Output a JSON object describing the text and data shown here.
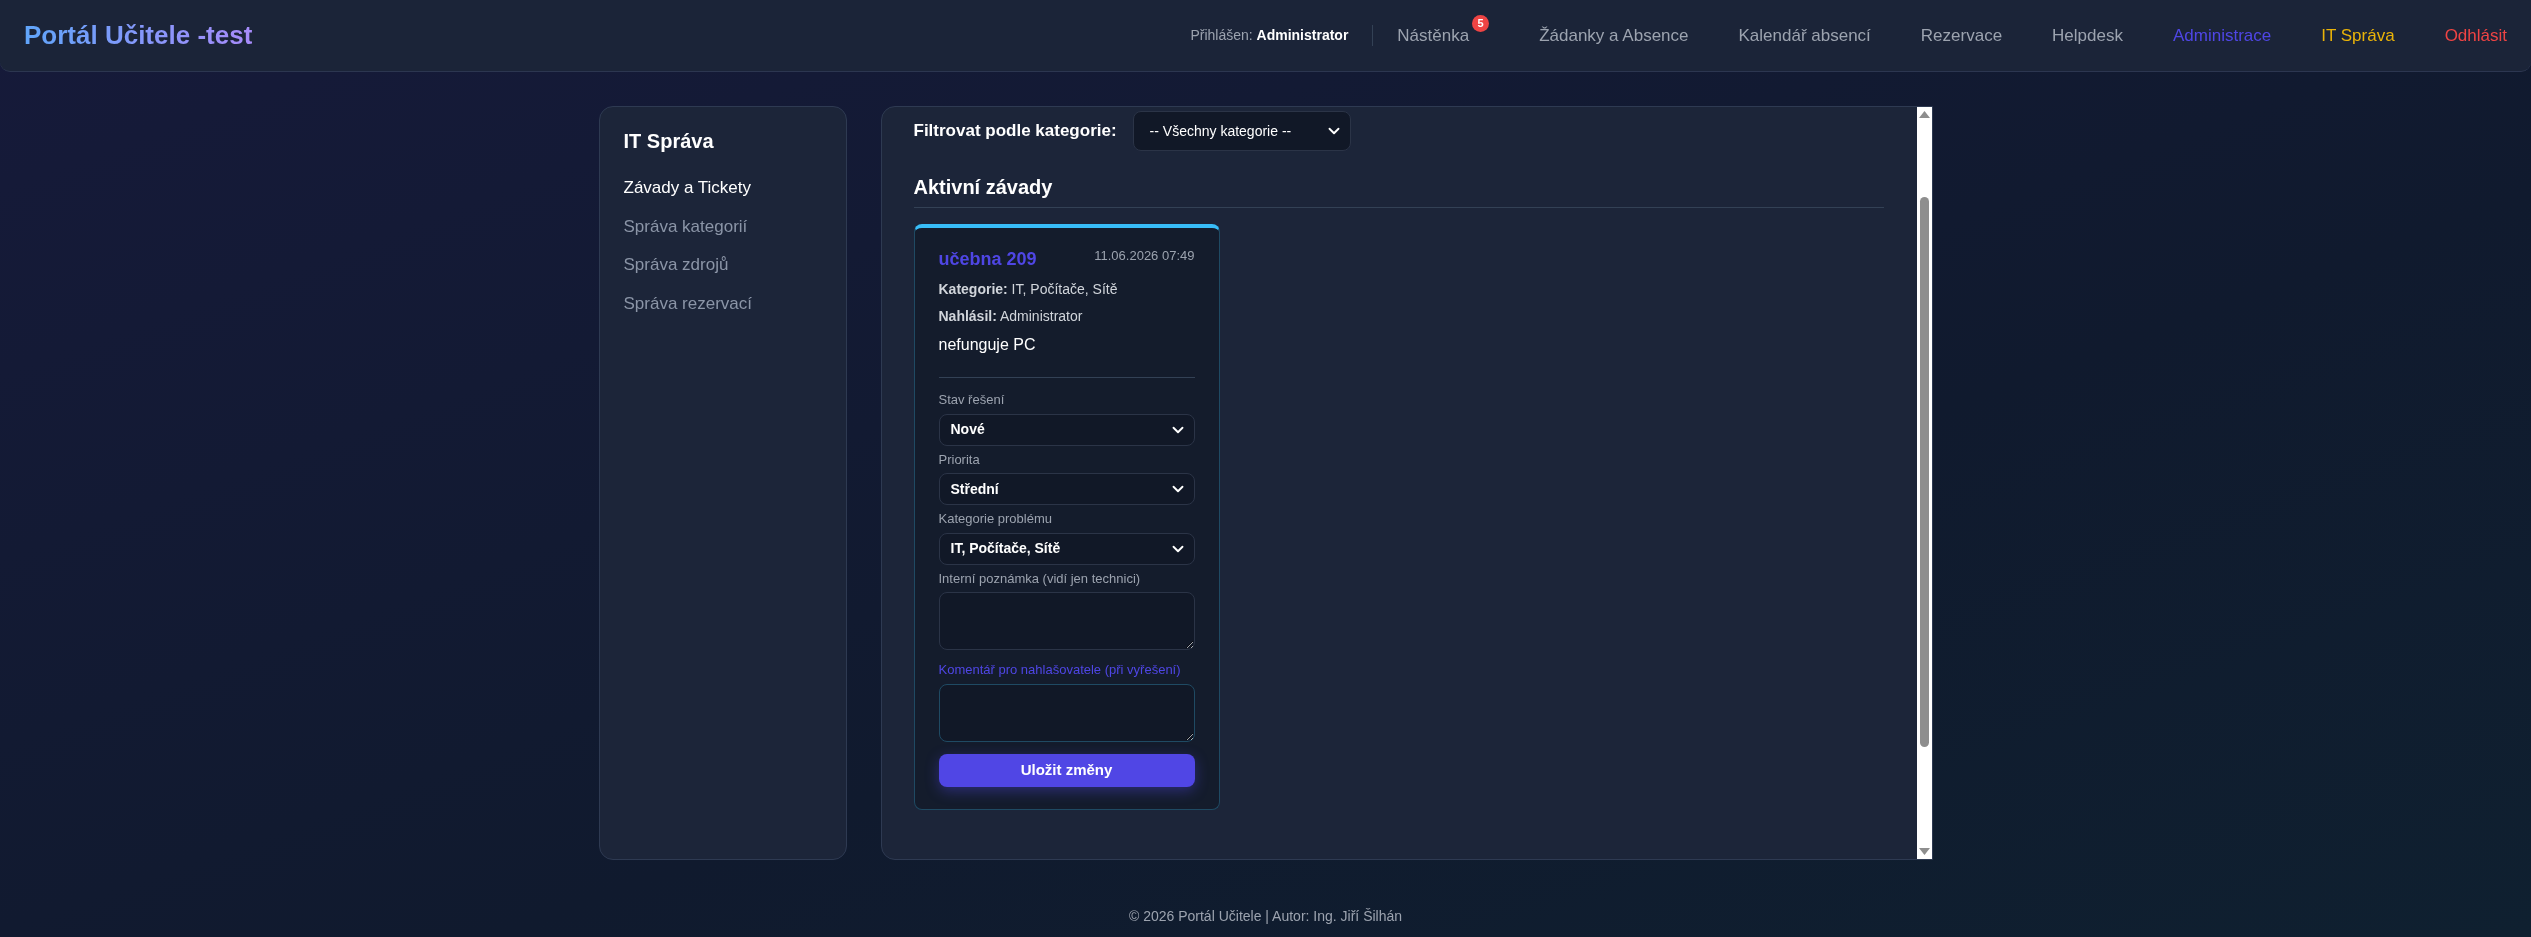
{
  "brand": "Portál Učitele -test",
  "user": {
    "label": "Přihlášen:",
    "name": "Administrator"
  },
  "nav": [
    {
      "label": "Nástěnka",
      "badge": "5",
      "color": "#9ca3af"
    },
    {
      "label": "Žádanky a Absence",
      "color": "#9ca3af"
    },
    {
      "label": "Kalendář absencí",
      "color": "#9ca3af"
    },
    {
      "label": "Rezervace",
      "color": "#9ca3af"
    },
    {
      "label": "Helpdesk",
      "color": "#9ca3af"
    },
    {
      "label": "Administrace",
      "color": "#4f46e5"
    },
    {
      "label": "IT Správa",
      "color": "#eab308"
    },
    {
      "label": "Odhlásit",
      "color": "#ef4444"
    }
  ],
  "sidebar": {
    "title": "IT Správa",
    "items": [
      {
        "label": "Závady a Tickety",
        "selected": true
      },
      {
        "label": "Správa kategorií",
        "selected": false
      },
      {
        "label": "Správa zdrojů",
        "selected": false
      },
      {
        "label": "Správa rezervací",
        "selected": false
      }
    ]
  },
  "filter": {
    "label": "Filtrovat podle kategorie:",
    "value": "-- Všechny kategorie --"
  },
  "section_title": "Aktivní závady",
  "tickets": [
    {
      "title": "učebna 209",
      "date": "11.06.2026 07:49",
      "category_label": "Kategorie:",
      "category": "IT, Počítače, Sítě",
      "reporter_label": "Nahlásil:",
      "reporter": "Administrator",
      "description": "nefunguje PC",
      "fields": [
        {
          "kind": "select",
          "label": "Stav řešení",
          "value": "Nové",
          "accent": false
        },
        {
          "kind": "select",
          "label": "Priorita",
          "value": "Střední",
          "accent": false
        },
        {
          "kind": "select",
          "label": "Kategorie problému",
          "value": "IT, Počítače, Sítě",
          "accent": false
        },
        {
          "kind": "textarea",
          "label": "Interní poznámka (vidí jen technici)",
          "accent": false
        },
        {
          "kind": "textarea",
          "label": "Komentář pro nahlašovatele (při vyřešení)",
          "accent": true
        }
      ],
      "button": "Uložit změny"
    }
  ],
  "footer": "© 2026 Portál Učitele | Autor: Ing. Jiří Šilhán"
}
